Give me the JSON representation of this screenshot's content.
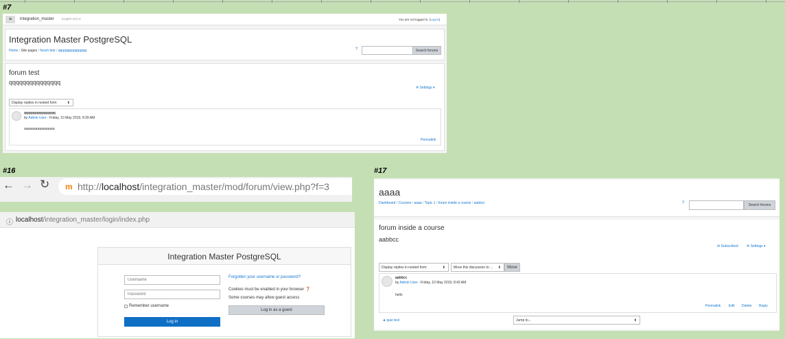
{
  "panels": {
    "p7": "#7",
    "p16": "#16",
    "p17": "#17"
  },
  "s7": {
    "site_name": "integration_master",
    "language": "English (en) ▾",
    "login_status": "You are not logged in. (",
    "login_link": "Log in",
    "login_close": ")",
    "title": "Integration Master PostgreSQL",
    "breadcrumb": [
      "Home",
      "Site pages",
      "forum test",
      "qqqqqqqqqqqqqqq"
    ],
    "search_button": "Search forums",
    "forum_name": "forum test",
    "discussion_title": "qqqqqqqqqqqqqqq",
    "settings": "Settings ▾",
    "display_mode": "Display replies in nested form",
    "post_subject": "qqqqqqqqqqqqqqq",
    "post_by": "by",
    "post_author": "Admin User",
    "post_date": " - Friday, 10 May 2019, 8:39 AM",
    "post_body": "aaaaaaaaaaaaaaaa",
    "permalink": "Permalink"
  },
  "s16": {
    "url_scheme": "http://",
    "url_host": "localhost",
    "url_path": "/integration_master/mod/forum/view.php?f=3",
    "url2_host": "localhost",
    "url2_path": "/integration_master/login/index.php",
    "title": "Integration Master PostgreSQL",
    "username_placeholder": "Username",
    "password_placeholder": "Password",
    "remember": "Remember username",
    "login_button": "Log in",
    "forgotten": "Forgotten your username or password?",
    "cookies": "Cookies must be enabled in your browser",
    "guest_info": "Some courses may allow guest access",
    "guest_button": "Log in as a guest"
  },
  "s17": {
    "course": "aaaa",
    "breadcrumb": [
      "Dashboard",
      "Courses",
      "aaaa",
      "Topic 1",
      "forum inside a course",
      "aabbcc"
    ],
    "search_button": "Search forums",
    "forum_name": "forum inside a course",
    "discussion_title": "aabbcc",
    "subscribed": "Subscribed",
    "settings": "Settings ▾",
    "display_mode": "Display replies in nested form",
    "move_select": "Move this discussion to ...",
    "move_button": "Move",
    "post_subject": "aabbcc",
    "post_by": "by",
    "post_author": "Admin User",
    "post_date": " - Friday, 10 May 2019, 8:43 AM",
    "post_body": "hello",
    "actions": [
      "Permalink",
      "Edit",
      "Delete",
      "Reply"
    ],
    "prev_link": "◄ quiz test",
    "jump_to": "Jump to..."
  },
  "colors": {
    "background": "#c5dfb4",
    "link": "#1177d1",
    "primary_button": "#0f6fc5"
  }
}
